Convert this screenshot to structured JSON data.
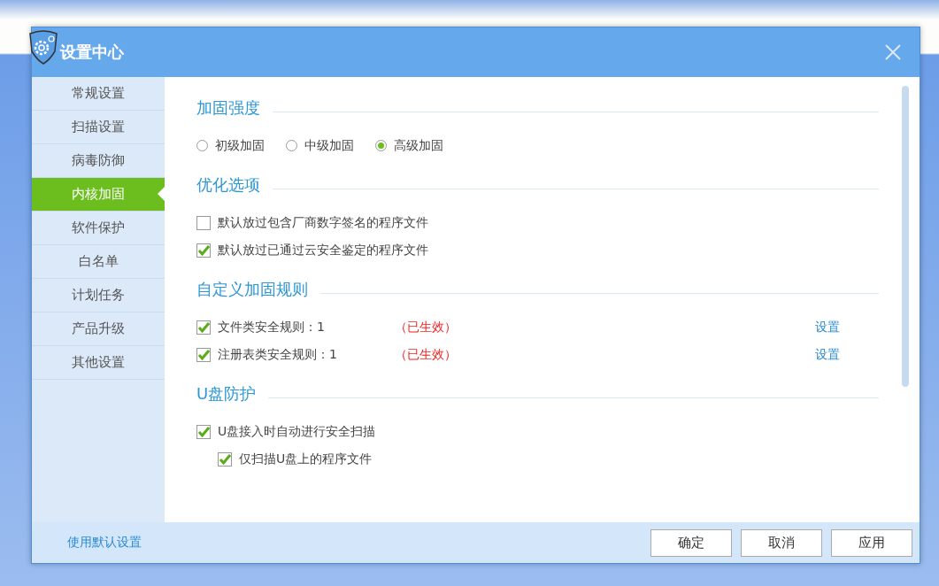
{
  "window": {
    "title": "设置中心"
  },
  "sidebar": {
    "items": [
      {
        "label": "常规设置",
        "selected": false
      },
      {
        "label": "扫描设置",
        "selected": false
      },
      {
        "label": "病毒防御",
        "selected": false
      },
      {
        "label": "内核加固",
        "selected": true
      },
      {
        "label": "软件保护",
        "selected": false
      },
      {
        "label": "白名单",
        "selected": false
      },
      {
        "label": "计划任务",
        "selected": false
      },
      {
        "label": "产品升级",
        "selected": false
      },
      {
        "label": "其他设置",
        "selected": false
      }
    ]
  },
  "sections": [
    {
      "title": "加固强度",
      "items": [
        {
          "kind": "radios",
          "options": [
            {
              "label": "初级加固",
              "selected": false
            },
            {
              "label": "中级加固",
              "selected": false
            },
            {
              "label": "高级加固",
              "selected": true
            }
          ]
        }
      ]
    },
    {
      "title": "优化选项",
      "items": [
        {
          "kind": "checkbox",
          "label": "默认放过包含厂商数字签名的程序文件",
          "checked": false
        },
        {
          "kind": "checkbox",
          "label": "默认放过已通过云安全鉴定的程序文件",
          "checked": true
        }
      ]
    },
    {
      "title": "自定义加固规则",
      "items": [
        {
          "kind": "rule",
          "label": "文件类安全规则：1",
          "checked": true,
          "status": "（已生效）",
          "link": "设置"
        },
        {
          "kind": "rule",
          "label": "注册表类安全规则：1",
          "checked": true,
          "status": "（已生效）",
          "link": "设置"
        }
      ]
    },
    {
      "title": "U盘防护",
      "items": [
        {
          "kind": "checkbox",
          "label": "U盘接入时自动进行安全扫描",
          "checked": true,
          "children": [
            {
              "kind": "checkbox",
              "label": "仅扫描U盘上的程序文件",
              "checked": true
            }
          ]
        }
      ]
    }
  ],
  "footer": {
    "link": "使用默认设置",
    "buttons": [
      "确定",
      "取消",
      "应用"
    ]
  }
}
